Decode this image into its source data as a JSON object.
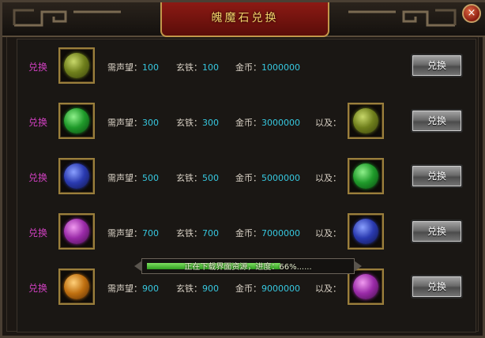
{
  "title": "魄魔石兑换",
  "close_label": "×",
  "rows": [
    {
      "exchange_label": "兑换",
      "rep_label": "需声望：",
      "rep": "100",
      "iron_label": "玄铁：",
      "iron": "100",
      "gold_label": "金币：",
      "gold": "1000000",
      "also_label": "",
      "button": "兑换",
      "gem": "olive-gem-icon",
      "req_gem": null
    },
    {
      "exchange_label": "兑换",
      "rep_label": "需声望：",
      "rep": "300",
      "iron_label": "玄铁：",
      "iron": "300",
      "gold_label": "金币：",
      "gold": "3000000",
      "also_label": "以及：",
      "button": "兑换",
      "gem": "green-gem-icon",
      "req_gem": "olive-gem-icon"
    },
    {
      "exchange_label": "兑换",
      "rep_label": "需声望：",
      "rep": "500",
      "iron_label": "玄铁：",
      "iron": "500",
      "gold_label": "金币：",
      "gold": "5000000",
      "also_label": "以及：",
      "button": "兑换",
      "gem": "blue-gem-icon",
      "req_gem": "green-gem-icon"
    },
    {
      "exchange_label": "兑换",
      "rep_label": "需声望：",
      "rep": "700",
      "iron_label": "玄铁：",
      "iron": "700",
      "gold_label": "金币：",
      "gold": "7000000",
      "also_label": "以及：",
      "button": "兑换",
      "gem": "purple-gem-icon",
      "req_gem": "blue-gem-icon"
    },
    {
      "exchange_label": "兑换",
      "rep_label": "需声望：",
      "rep": "900",
      "iron_label": "玄铁：",
      "iron": "900",
      "gold_label": "金币：",
      "gold": "9000000",
      "also_label": "以及：",
      "button": "兑换",
      "gem": "orange-gem-icon",
      "req_gem": "purple-gem-icon"
    }
  ],
  "gem_colors": {
    "olive-gem-icon": [
      "#c8d86a",
      "#6f7f1c",
      "#3b430c"
    ],
    "green-gem-icon": [
      "#8ef08a",
      "#1f9a2a",
      "#0b4a10"
    ],
    "blue-gem-icon": [
      "#8aa0ff",
      "#2a3ab0",
      "#10164a"
    ],
    "purple-gem-icon": [
      "#f09af0",
      "#9a2aa8",
      "#44104a"
    ],
    "orange-gem-icon": [
      "#ffd07a",
      "#c07010",
      "#5a2c04"
    ]
  },
  "loading": {
    "text": "正在下载界面资源，进度：66%......",
    "progress": 0.66
  }
}
